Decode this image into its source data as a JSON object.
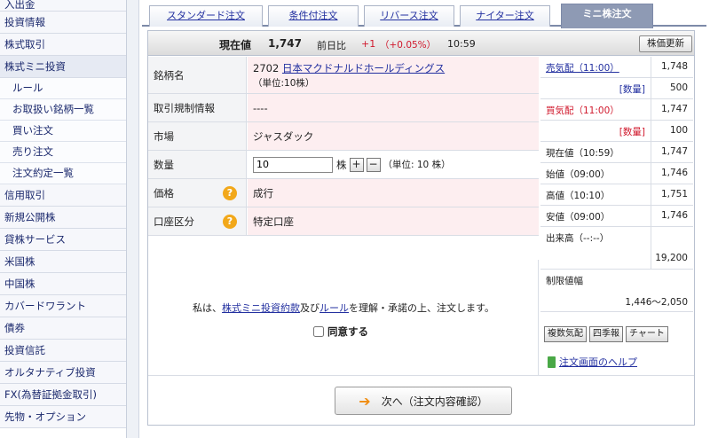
{
  "sidebar": {
    "items": [
      {
        "label": "入出金"
      },
      {
        "label": "投資情報"
      },
      {
        "label": "株式取引"
      },
      {
        "label": "株式ミニ投資"
      }
    ],
    "subitems": [
      {
        "label": "ルール"
      },
      {
        "label": "お取扱い銘柄一覧"
      },
      {
        "label": "買い注文"
      },
      {
        "label": "売り注文"
      },
      {
        "label": "注文約定一覧"
      }
    ],
    "items_after": [
      {
        "label": "信用取引"
      },
      {
        "label": "新規公開株"
      },
      {
        "label": "貸株サービス"
      },
      {
        "label": "米国株"
      },
      {
        "label": "中国株"
      },
      {
        "label": "カバードワラント"
      },
      {
        "label": "債券"
      },
      {
        "label": "投資信託"
      },
      {
        "label": "オルタナティブ投資"
      },
      {
        "label": "FX(為替証拠金取引)"
      },
      {
        "label": "先物・オプション"
      }
    ]
  },
  "tabs": [
    {
      "label": "スタンダード注文"
    },
    {
      "label": "条件付注文"
    },
    {
      "label": "リバース注文"
    },
    {
      "label": "ナイター注文"
    },
    {
      "label": "ミニ株注文"
    }
  ],
  "price_bar": {
    "label": "現在値",
    "price": "1,747",
    "change_label": "前日比",
    "change": "+1",
    "change_pct": "（+0.05%）",
    "time": "10:59",
    "refresh_button": "株価更新"
  },
  "form": {
    "stock": {
      "label": "銘柄名",
      "code": "2702",
      "name": "日本マクドナルドホールディングス",
      "unit": "（単位:10株）"
    },
    "regulation": {
      "label": "取引規制情報",
      "value": "----"
    },
    "market": {
      "label": "市場",
      "value": "ジャスダック"
    },
    "quantity": {
      "label": "数量",
      "value": "10",
      "suffix": "株",
      "plus": "+",
      "minus": "−",
      "unit_note": "（単位: 10 株）"
    },
    "price": {
      "label": "価格",
      "value": "成行"
    },
    "account": {
      "label": "口座区分",
      "value": "特定口座"
    },
    "help_icon": "question-icon",
    "help_glyph": "?"
  },
  "agreement": {
    "prefix": "私は、",
    "link1": "株式ミニ投資約款",
    "middle": "及び",
    "link2": "ルール",
    "suffix": "を理解・承諾の上、注文します。",
    "checkbox_label": "同意する"
  },
  "next_button": {
    "arrow": "➔",
    "label": "次へ（注文内容確認）"
  },
  "board": {
    "sell_quote": {
      "label": "売気配（11:00）",
      "value": "1,748"
    },
    "sell_qty": {
      "label": "[数量]",
      "value": "500"
    },
    "buy_quote": {
      "label": "買気配（11:00）",
      "value": "1,747"
    },
    "buy_qty": {
      "label": "[数量]",
      "value": "100"
    },
    "current": {
      "label": "現在値（10:59）",
      "value": "1,747"
    },
    "open": {
      "label": "始値（09:00）",
      "value": "1,746"
    },
    "high": {
      "label": "高値（10:10）",
      "value": "1,751"
    },
    "low": {
      "label": "安値（09:00）",
      "value": "1,746"
    },
    "volume": {
      "label": "出来高（--:--）",
      "value": "19,200"
    },
    "limit": {
      "label": "制限値幅",
      "value": "1,446〜2,050"
    },
    "buttons": [
      "複数気配",
      "四季報",
      "チャート"
    ],
    "help_link": "注文画面のヘルプ"
  },
  "colors": {
    "accent_red": "#d0182c",
    "link_blue": "#2330a0",
    "pink_cell": "#fdeef0",
    "help_orange": "#f2a81a"
  }
}
